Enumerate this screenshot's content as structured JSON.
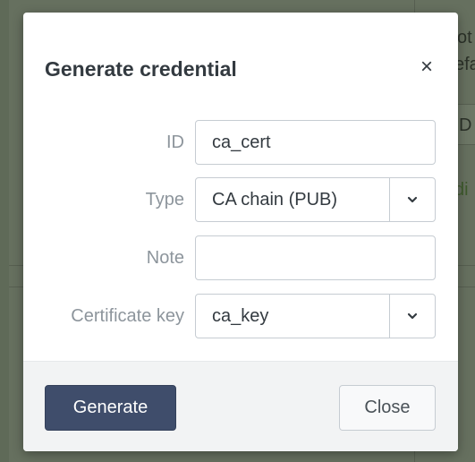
{
  "background": {
    "fragments": [
      "ot",
      "efa",
      "D",
      "di"
    ]
  },
  "dialog": {
    "title": "Generate credential",
    "close_icon": "close-icon",
    "close_glyph": "×"
  },
  "form": {
    "id": {
      "label": "ID",
      "value": "ca_cert"
    },
    "type": {
      "label": "Type",
      "selected": "CA chain (PUB)",
      "icon": "chevron-down-icon"
    },
    "note": {
      "label": "Note",
      "value": ""
    },
    "certificate_key": {
      "label": "Certificate key",
      "selected": "ca_key",
      "icon": "chevron-down-icon"
    }
  },
  "footer": {
    "generate_label": "Generate",
    "close_label": "Close"
  },
  "colors": {
    "primary_button": "#3f4d6b",
    "label_text": "#8d959c",
    "footer_bg": "#f2f3f4",
    "backdrop": "#5f6a58"
  }
}
